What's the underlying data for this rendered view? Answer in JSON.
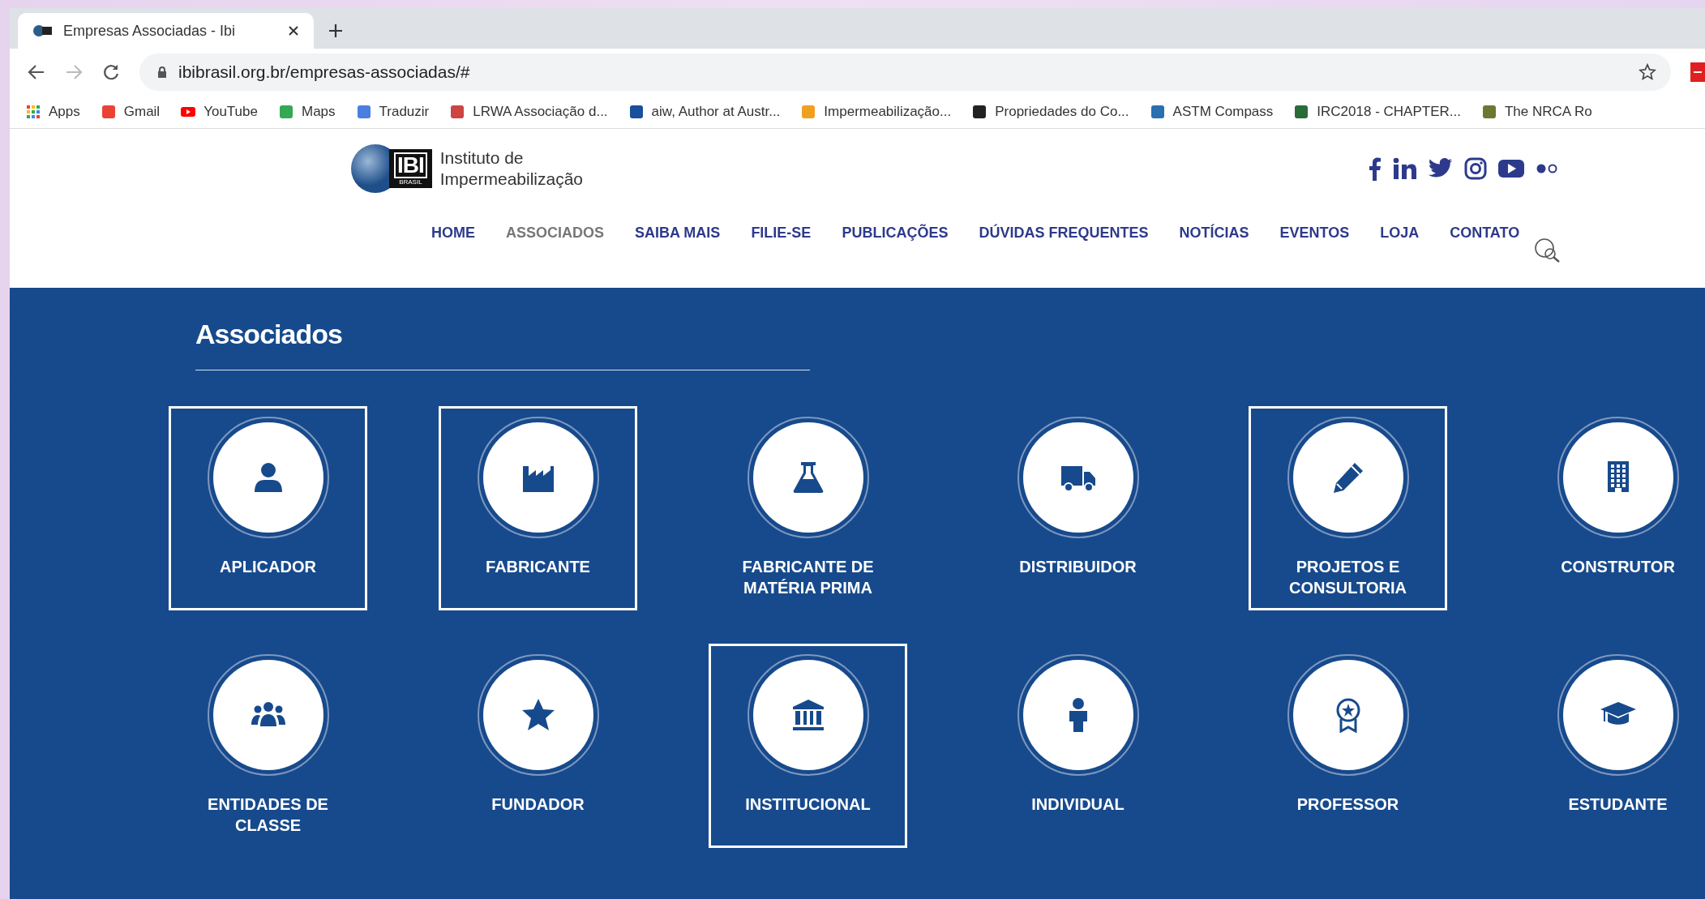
{
  "browser": {
    "tab_title": "Empresas Associadas - Ibi",
    "url": "ibibrasil.org.br/empresas-associadas/#",
    "bookmarks": [
      "Apps",
      "Gmail",
      "YouTube",
      "Maps",
      "Traduzir",
      "LRWA Associação d...",
      "aiw, Author at Austr...",
      "Impermeabilização...",
      "Propriedades do Co...",
      "ASTM Compass",
      "IRC2018 - CHAPTER...",
      "The NRCA Ro"
    ]
  },
  "site": {
    "logo_mark": "IBI",
    "logo_sub": "BRASIL",
    "logo_text": [
      "Instituto de",
      "Impermeabilização"
    ],
    "nav": [
      {
        "label": "HOME",
        "selected": false
      },
      {
        "label": "ASSOCIADOS",
        "selected": true
      },
      {
        "label": "SAIBA MAIS",
        "selected": false
      },
      {
        "label": "FILIE-SE",
        "selected": false
      },
      {
        "label": "PUBLICAÇÕES",
        "selected": false
      },
      {
        "label": "DÚVIDAS FREQUENTES",
        "selected": false
      },
      {
        "label": "NOTÍCIAS",
        "selected": false
      },
      {
        "label": "EVENTOS",
        "selected": false
      },
      {
        "label": "LOJA",
        "selected": false
      },
      {
        "label": "CONTATO",
        "selected": false
      }
    ]
  },
  "section": {
    "title": "Associados",
    "categories": [
      {
        "label": "APLICADOR",
        "outlined": true
      },
      {
        "label": "FABRICANTE",
        "outlined": true
      },
      {
        "label": "FABRICANTE DE MATÉRIA PRIMA",
        "outlined": false
      },
      {
        "label": "DISTRIBUIDOR",
        "outlined": false
      },
      {
        "label": "PROJETOS E CONSULTORIA",
        "outlined": true
      },
      {
        "label": "CONSTRUTOR",
        "outlined": false
      },
      {
        "label": "ENTIDADES DE CLASSE",
        "outlined": false
      },
      {
        "label": "FUNDADOR",
        "outlined": false
      },
      {
        "label": "INSTITUCIONAL",
        "outlined": true
      },
      {
        "label": "INDIVIDUAL",
        "outlined": false
      },
      {
        "label": "PROFESSOR",
        "outlined": false
      },
      {
        "label": "ESTUDANTE",
        "outlined": false
      }
    ]
  }
}
